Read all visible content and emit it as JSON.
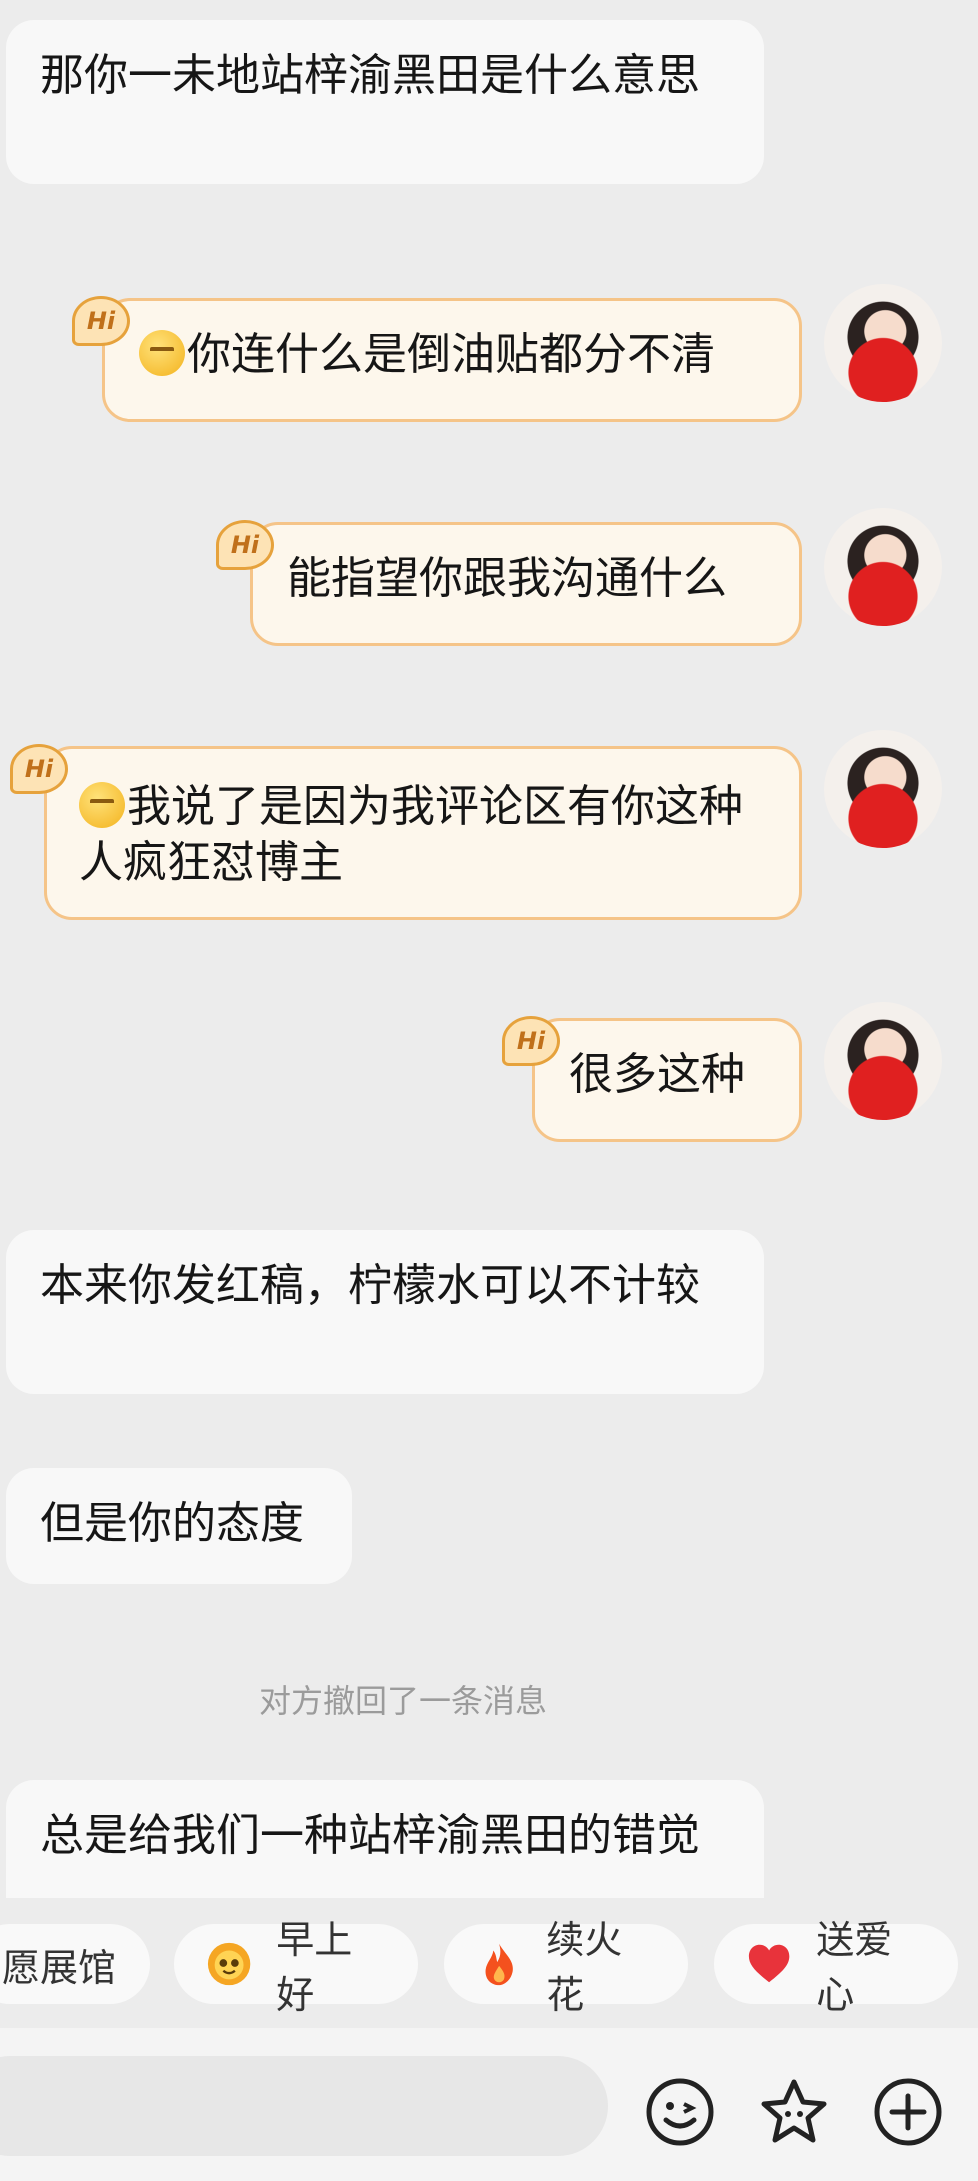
{
  "messages": {
    "m1": "那你一未地站梓渝黑田是什么意思",
    "m2": "你连什么是倒油贴都分不清",
    "m3": "能指望你跟我沟通什么",
    "m4": "我说了是因为我评论区有你这种人疯狂怼博主",
    "m5": "很多这种",
    "m6": "本来你发红稿，柠檬水可以不计较",
    "m7": "但是你的态度",
    "m8": "总是给我们一种站梓渝黑田的错觉"
  },
  "hi_badge": "Hi",
  "system_notice": "对方撤回了一条消息",
  "quick_replies": [
    {
      "label": "愿展馆",
      "icon": "gift-icon"
    },
    {
      "label": "早上好",
      "icon": "sun-face-icon"
    },
    {
      "label": "续火花",
      "icon": "flame-icon"
    },
    {
      "label": "送爱心",
      "icon": "heart-icon"
    }
  ],
  "input": {
    "placeholder": ""
  },
  "toolbar": {
    "emoji": "emoji-icon",
    "sticker": "star-sticker-icon",
    "more": "plus-circle-icon"
  },
  "colors": {
    "bubble_self_border": "#f5c488",
    "bubble_self_bg": "#fdf7ec",
    "bubble_other_bg": "#f8f8f8",
    "heart": "#e8333b",
    "flame": "#f4511e"
  }
}
